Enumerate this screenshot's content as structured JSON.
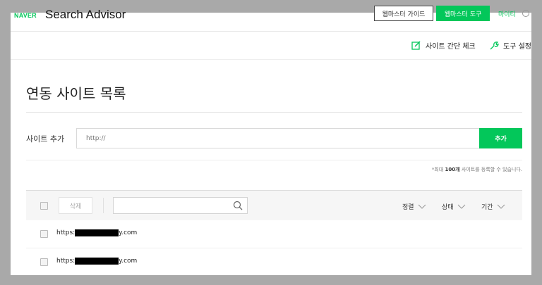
{
  "header": {
    "brand": "NAVER",
    "title": "Search Advisor",
    "guide_button": "웹마스터 가이드",
    "tools_button": "웹마스터 도구",
    "mypage": "마이티"
  },
  "subnav": {
    "site_check": "사이트 간단 체크",
    "tool_settings": "도구 설정"
  },
  "page": {
    "title": "연동 사이트 목록"
  },
  "add_site": {
    "label": "사이트 추가",
    "placeholder": "http://",
    "button": "추가",
    "note_prefix": "*최대 ",
    "note_count": "100개",
    "note_suffix": " 사이트를 등록할 수 있습니다."
  },
  "list": {
    "delete_button": "삭제",
    "sort_labels": [
      "정렬",
      "상태",
      "기간"
    ],
    "rows": [
      {
        "url_prefix": "https:",
        "url_suffix": "y.com"
      },
      {
        "url_prefix": "https:",
        "url_suffix": "y.com"
      }
    ]
  },
  "colors": {
    "accent": "#03c75a",
    "overlay": "#a9a9a9"
  }
}
